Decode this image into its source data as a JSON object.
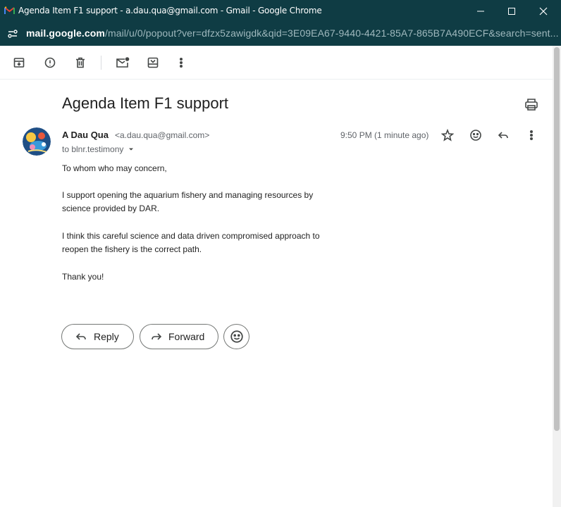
{
  "window": {
    "title": "Agenda Item F1 support - a.dau.qua@gmail.com - Gmail - Google Chrome"
  },
  "address": {
    "host": "mail.google.com",
    "path": "/mail/u/0/popout?ver=dfzx5zawigdk&qid=3E09EA67-9440-4421-85A7-865B7A490ECF&search=sent..."
  },
  "toolbar": {
    "icons": [
      "archive-icon",
      "report-spam-icon",
      "delete-icon",
      "mark-unread-icon",
      "move-to-icon",
      "more-vert-icon"
    ]
  },
  "email": {
    "subject": "Agenda Item F1 support",
    "sender_name": "A Dau Qua",
    "sender_email": "<a.dau.qua@gmail.com>",
    "to_line": "to blnr.testimony",
    "time": "9:50 PM (1 minute ago)",
    "body": {
      "greeting": "To whom who may concern,",
      "p1_line1": "I support opening the aquarium fishery and managing resources by",
      "p1_line2": "science provided by DAR.",
      "p2_line1": "I think this careful science and data driven compromised approach to",
      "p2_line2": "reopen the fishery is the correct path.",
      "closing": "Thank you!"
    }
  },
  "actions": {
    "reply_label": "Reply",
    "forward_label": "Forward"
  },
  "colors": {
    "chrome_frame": "#0f3c44",
    "text_primary": "#1f1f1f",
    "text_secondary": "#5f6368"
  }
}
